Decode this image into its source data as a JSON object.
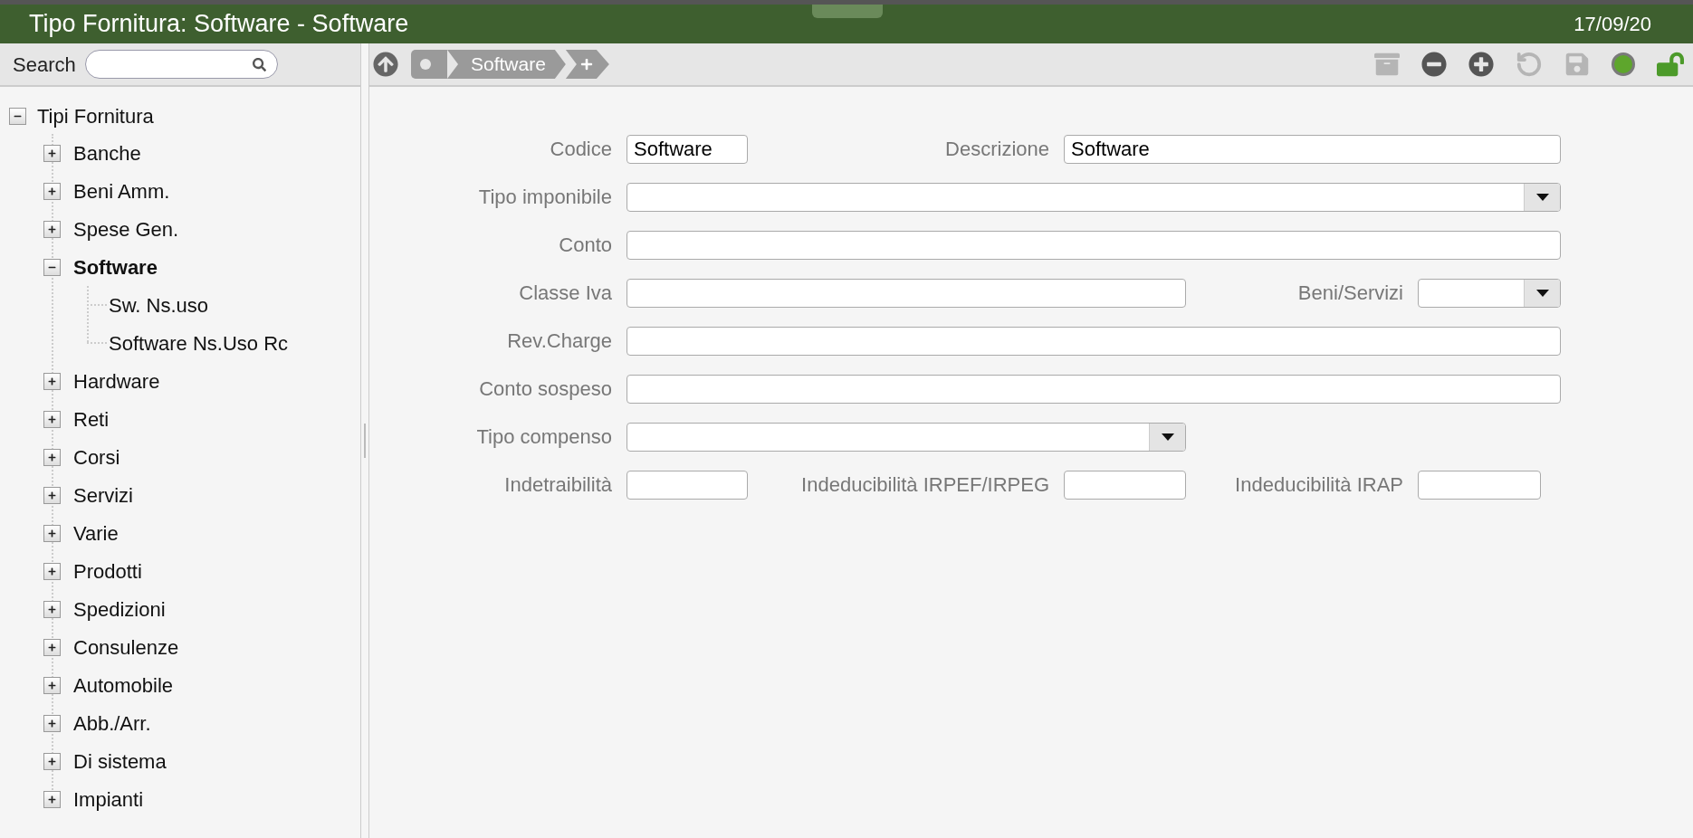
{
  "header": {
    "title": "Tipo Fornitura: Software - Software",
    "date": "17/09/20"
  },
  "search": {
    "label": "Search"
  },
  "tree": {
    "label": "Tipi Fornitura",
    "expanded": true,
    "selected": false,
    "children": [
      {
        "label": "Banche",
        "expanded": false,
        "selected": false
      },
      {
        "label": "Beni Amm.",
        "expanded": false,
        "selected": false
      },
      {
        "label": "Spese Gen.",
        "expanded": false,
        "selected": false
      },
      {
        "label": "Software",
        "expanded": true,
        "selected": true,
        "children": [
          {
            "label": "Sw. Ns.uso",
            "selected": false
          },
          {
            "label": "Software Ns.Uso Rc",
            "selected": false
          }
        ]
      },
      {
        "label": "Hardware",
        "expanded": false,
        "selected": false
      },
      {
        "label": "Reti",
        "expanded": false,
        "selected": false
      },
      {
        "label": "Corsi",
        "expanded": false,
        "selected": false
      },
      {
        "label": "Servizi",
        "expanded": false,
        "selected": false
      },
      {
        "label": "Varie",
        "expanded": false,
        "selected": false
      },
      {
        "label": "Prodotti",
        "expanded": false,
        "selected": false
      },
      {
        "label": "Spedizioni",
        "expanded": false,
        "selected": false
      },
      {
        "label": "Consulenze",
        "expanded": false,
        "selected": false
      },
      {
        "label": "Automobile",
        "expanded": false,
        "selected": false
      },
      {
        "label": "Abb./Arr.",
        "expanded": false,
        "selected": false
      },
      {
        "label": "Di sistema",
        "expanded": false,
        "selected": false
      },
      {
        "label": "Impianti",
        "expanded": false,
        "selected": false
      }
    ]
  },
  "breadcrumb": {
    "items": [
      "Software"
    ]
  },
  "toolbar": [
    {
      "kind": "archive",
      "disabled": true
    },
    {
      "kind": "remove",
      "disabled": false
    },
    {
      "kind": "add",
      "disabled": false
    },
    {
      "kind": "undo",
      "disabled": true
    },
    {
      "kind": "save",
      "disabled": true
    },
    {
      "kind": "status",
      "disabled": false
    },
    {
      "kind": "unlock",
      "disabled": false
    }
  ],
  "form": {
    "rows": [
      [
        {
          "label": "Codice",
          "kind": "text",
          "value": "Software"
        },
        {
          "label": "Descrizione",
          "kind": "text",
          "value": "Software"
        }
      ],
      [
        {
          "label": "Tipo imponibile",
          "kind": "select"
        }
      ],
      [
        {
          "label": "Conto",
          "kind": "text"
        }
      ],
      [
        {
          "label": "Classe Iva",
          "kind": "text"
        },
        null,
        {
          "label": "Beni/Servizi",
          "kind": "select"
        }
      ],
      [
        {
          "label": "Rev.Charge",
          "kind": "text"
        }
      ],
      [
        {
          "label": "Conto sospeso",
          "kind": "text"
        }
      ],
      [
        {
          "label": "Tipo compenso",
          "kind": "select"
        }
      ],
      [
        {
          "label": "Indetraibilità",
          "kind": "text"
        },
        {
          "label": "Indeducibilità IRPEF/IRPEG",
          "kind": "text"
        },
        {
          "label": "Indeducibilità IRAP",
          "kind": "text"
        }
      ]
    ]
  }
}
